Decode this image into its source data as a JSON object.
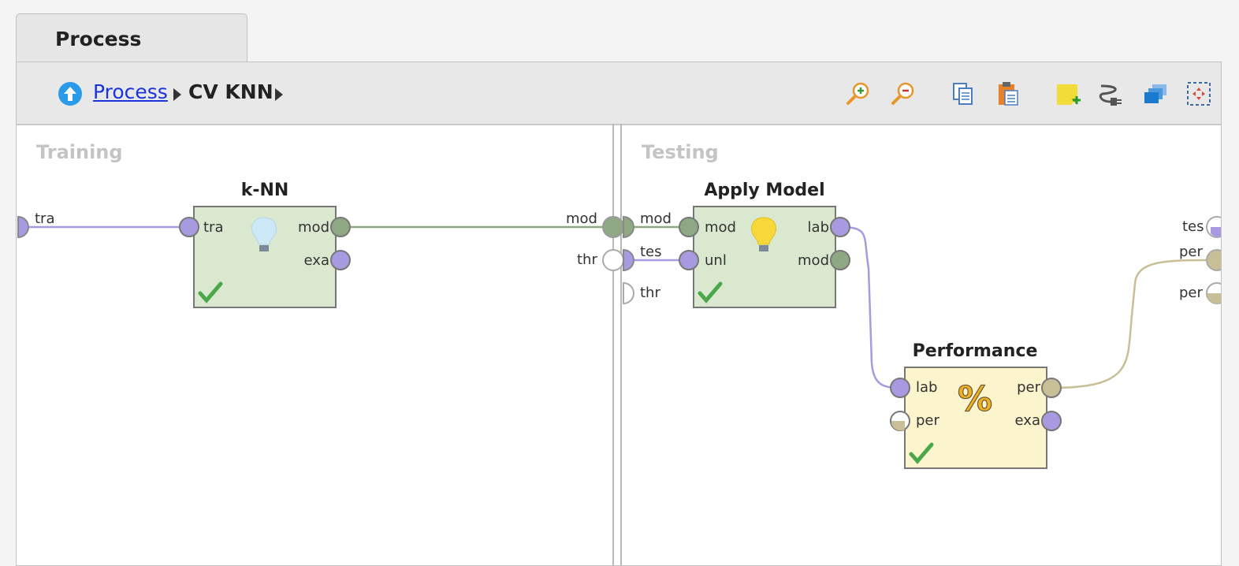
{
  "tab": {
    "label": "Process"
  },
  "breadcrumb": {
    "root": "Process",
    "current": "CV KNN"
  },
  "toolbar": {
    "icons": [
      "zoom-in-icon",
      "zoom-out-icon",
      "copy-icon",
      "paste-icon",
      "add-note-icon",
      "connect-icon",
      "layers-icon",
      "fit-view-icon"
    ]
  },
  "panels": {
    "training": "Training",
    "testing": "Testing"
  },
  "operators": {
    "knn": {
      "title": "k-NN",
      "in1": "tra",
      "out1": "mod",
      "out2": "exa"
    },
    "apply": {
      "title": "Apply Model",
      "in1": "mod",
      "in2": "unl",
      "out1": "lab",
      "out2": "mod"
    },
    "perf": {
      "title": "Performance",
      "in1": "lab",
      "in2": "per",
      "out1": "per",
      "out2": "exa"
    }
  },
  "ports": {
    "training_in": "tra",
    "training_out": "mod",
    "training_out2": "thr",
    "testing_in1": "mod",
    "testing_in2": "tes",
    "testing_in3": "thr",
    "testing_out1": "tes",
    "testing_out2": "per",
    "testing_out3": "per"
  },
  "colors": {
    "model_port": "#8ea884",
    "example_port": "#a89ae0",
    "perf_port": "#c8bf96",
    "op_green": "#dbe8d0",
    "op_yellow": "#fbf4cc",
    "check": "#4aa84a"
  }
}
